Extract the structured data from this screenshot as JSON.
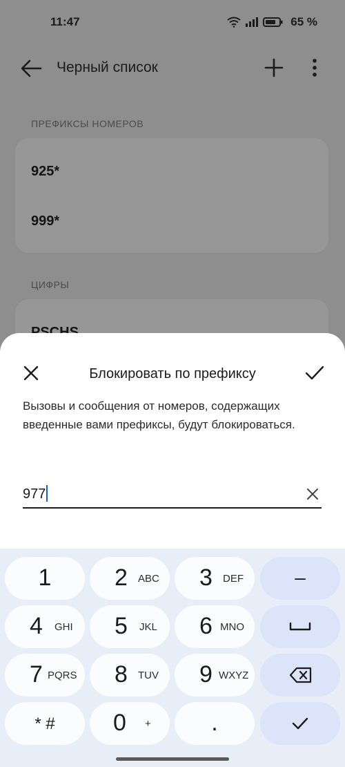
{
  "status": {
    "time": "11:47",
    "battery": "65 %"
  },
  "topbar": {
    "title": "Черный список"
  },
  "sections": [
    {
      "header": "ПРЕФИКСЫ НОМЕРОВ",
      "items": [
        "925*",
        "999*"
      ]
    },
    {
      "header": "ЦИФРЫ",
      "items": [
        "PSCHS"
      ]
    }
  ],
  "sheet": {
    "title": "Блокировать по префиксу",
    "description": "Вызовы и сообщения от номеров, содержащих введенные вами префиксы, будут блокироваться.",
    "input_value": "977"
  },
  "keyboard": {
    "keys": [
      {
        "digit": "1",
        "letters": ""
      },
      {
        "digit": "2",
        "letters": "ABC"
      },
      {
        "digit": "3",
        "letters": "DEF"
      },
      {
        "digit": "4",
        "letters": "GHI"
      },
      {
        "digit": "5",
        "letters": "JKL"
      },
      {
        "digit": "6",
        "letters": "MNO"
      },
      {
        "digit": "7",
        "letters": "PQRS"
      },
      {
        "digit": "8",
        "letters": "TUV"
      },
      {
        "digit": "9",
        "letters": "WXYZ"
      },
      {
        "digit": "* #",
        "letters": ""
      },
      {
        "digit": "0",
        "letters": "+"
      },
      {
        "digit": ".",
        "letters": ""
      }
    ],
    "fn_keys": {
      "minus": "–"
    }
  }
}
